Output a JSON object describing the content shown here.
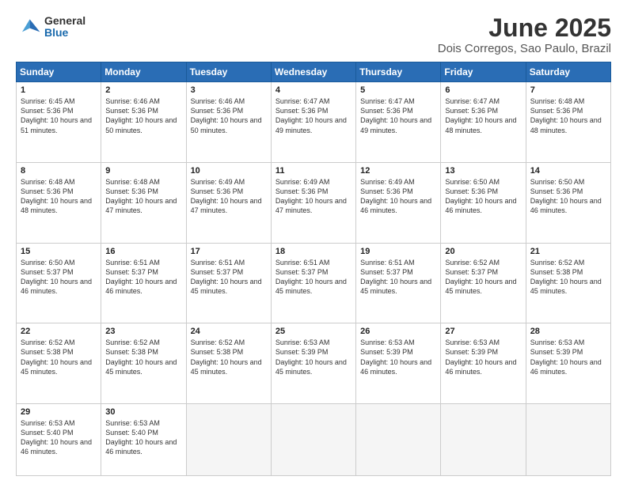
{
  "logo": {
    "general": "General",
    "blue": "Blue"
  },
  "title": "June 2025",
  "subtitle": "Dois Corregos, Sao Paulo, Brazil",
  "headers": [
    "Sunday",
    "Monday",
    "Tuesday",
    "Wednesday",
    "Thursday",
    "Friday",
    "Saturday"
  ],
  "weeks": [
    [
      {
        "day": 1,
        "rise": "6:45 AM",
        "set": "5:36 PM",
        "daylight": "10 hours and 51 minutes."
      },
      {
        "day": 2,
        "rise": "6:46 AM",
        "set": "5:36 PM",
        "daylight": "10 hours and 50 minutes."
      },
      {
        "day": 3,
        "rise": "6:46 AM",
        "set": "5:36 PM",
        "daylight": "10 hours and 50 minutes."
      },
      {
        "day": 4,
        "rise": "6:47 AM",
        "set": "5:36 PM",
        "daylight": "10 hours and 49 minutes."
      },
      {
        "day": 5,
        "rise": "6:47 AM",
        "set": "5:36 PM",
        "daylight": "10 hours and 49 minutes."
      },
      {
        "day": 6,
        "rise": "6:47 AM",
        "set": "5:36 PM",
        "daylight": "10 hours and 48 minutes."
      },
      {
        "day": 7,
        "rise": "6:48 AM",
        "set": "5:36 PM",
        "daylight": "10 hours and 48 minutes."
      }
    ],
    [
      {
        "day": 8,
        "rise": "6:48 AM",
        "set": "5:36 PM",
        "daylight": "10 hours and 48 minutes."
      },
      {
        "day": 9,
        "rise": "6:48 AM",
        "set": "5:36 PM",
        "daylight": "10 hours and 47 minutes."
      },
      {
        "day": 10,
        "rise": "6:49 AM",
        "set": "5:36 PM",
        "daylight": "10 hours and 47 minutes."
      },
      {
        "day": 11,
        "rise": "6:49 AM",
        "set": "5:36 PM",
        "daylight": "10 hours and 47 minutes."
      },
      {
        "day": 12,
        "rise": "6:49 AM",
        "set": "5:36 PM",
        "daylight": "10 hours and 46 minutes."
      },
      {
        "day": 13,
        "rise": "6:50 AM",
        "set": "5:36 PM",
        "daylight": "10 hours and 46 minutes."
      },
      {
        "day": 14,
        "rise": "6:50 AM",
        "set": "5:36 PM",
        "daylight": "10 hours and 46 minutes."
      }
    ],
    [
      {
        "day": 15,
        "rise": "6:50 AM",
        "set": "5:37 PM",
        "daylight": "10 hours and 46 minutes."
      },
      {
        "day": 16,
        "rise": "6:51 AM",
        "set": "5:37 PM",
        "daylight": "10 hours and 46 minutes."
      },
      {
        "day": 17,
        "rise": "6:51 AM",
        "set": "5:37 PM",
        "daylight": "10 hours and 45 minutes."
      },
      {
        "day": 18,
        "rise": "6:51 AM",
        "set": "5:37 PM",
        "daylight": "10 hours and 45 minutes."
      },
      {
        "day": 19,
        "rise": "6:51 AM",
        "set": "5:37 PM",
        "daylight": "10 hours and 45 minutes."
      },
      {
        "day": 20,
        "rise": "6:52 AM",
        "set": "5:37 PM",
        "daylight": "10 hours and 45 minutes."
      },
      {
        "day": 21,
        "rise": "6:52 AM",
        "set": "5:38 PM",
        "daylight": "10 hours and 45 minutes."
      }
    ],
    [
      {
        "day": 22,
        "rise": "6:52 AM",
        "set": "5:38 PM",
        "daylight": "10 hours and 45 minutes."
      },
      {
        "day": 23,
        "rise": "6:52 AM",
        "set": "5:38 PM",
        "daylight": "10 hours and 45 minutes."
      },
      {
        "day": 24,
        "rise": "6:52 AM",
        "set": "5:38 PM",
        "daylight": "10 hours and 45 minutes."
      },
      {
        "day": 25,
        "rise": "6:53 AM",
        "set": "5:39 PM",
        "daylight": "10 hours and 45 minutes."
      },
      {
        "day": 26,
        "rise": "6:53 AM",
        "set": "5:39 PM",
        "daylight": "10 hours and 46 minutes."
      },
      {
        "day": 27,
        "rise": "6:53 AM",
        "set": "5:39 PM",
        "daylight": "10 hours and 46 minutes."
      },
      {
        "day": 28,
        "rise": "6:53 AM",
        "set": "5:39 PM",
        "daylight": "10 hours and 46 minutes."
      }
    ],
    [
      {
        "day": 29,
        "rise": "6:53 AM",
        "set": "5:40 PM",
        "daylight": "10 hours and 46 minutes."
      },
      {
        "day": 30,
        "rise": "6:53 AM",
        "set": "5:40 PM",
        "daylight": "10 hours and 46 minutes."
      },
      null,
      null,
      null,
      null,
      null
    ]
  ]
}
